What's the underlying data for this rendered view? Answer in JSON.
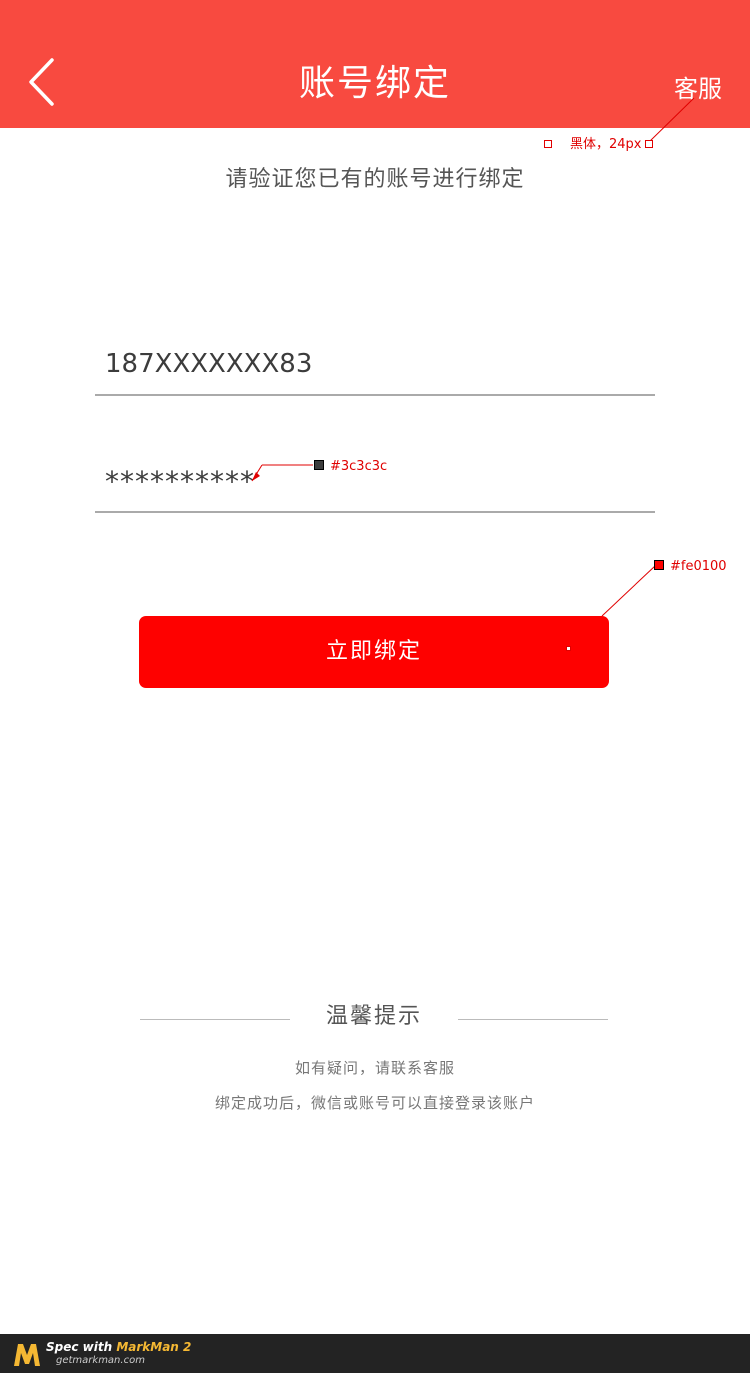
{
  "colors": {
    "header_bg": "#f84a40",
    "button_bg": "#fe0100",
    "text_dark": "#3c3c3c",
    "annotation": "#e00000"
  },
  "header": {
    "back_icon": "chevron-left-icon",
    "title": "账号绑定",
    "service_label": "客服"
  },
  "subtitle": "请验证您已有的账号进行绑定",
  "form": {
    "account_value": "187XXXXXXX83",
    "password_value": "**********",
    "submit_label": "立即绑定"
  },
  "annotations": {
    "font_spec": "黑体，24px",
    "text_color_spec": "#3c3c3c",
    "button_color_spec": "#fe0100"
  },
  "tips": {
    "title": "温馨提示",
    "lines": [
      "如有疑问，请联系客服",
      "绑定成功后，微信或账号可以直接登录该账户"
    ]
  },
  "footer": {
    "spec_prefix": "Spec with ",
    "brand": "MarkMan 2",
    "url": "getmarkman.com"
  }
}
